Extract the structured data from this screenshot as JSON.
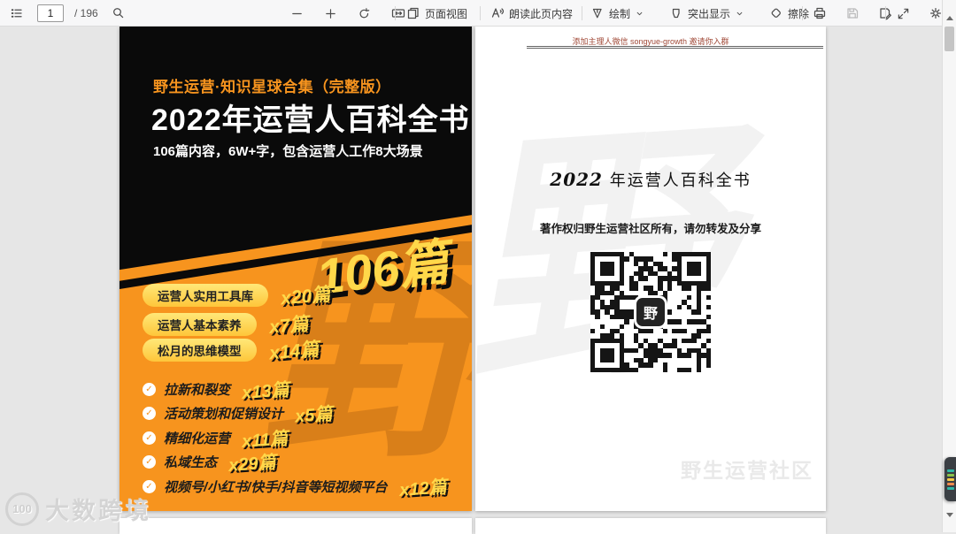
{
  "toolbar": {
    "page_input": "1",
    "page_total": "/ 196",
    "page_view_label": "页面视图",
    "read_aloud_label": "朗读此页内容",
    "draw_label": "绘制",
    "highlight_label": "突出显示",
    "erase_label": "擦除"
  },
  "left_page": {
    "kicker": "野生运营·知识星球合集（完整版）",
    "title": "2022年运营人百科全书",
    "subtitle": "106篇内容，6W+字，包含运营人工作8大场景",
    "badge": "106篇",
    "watermark": "野",
    "pills": [
      {
        "label": "运营人实用工具库",
        "count": "x20篇"
      },
      {
        "label": "运营人基本素养",
        "count": "x7篇"
      },
      {
        "label": "松月的思维模型",
        "count": "x14篇"
      }
    ],
    "checklist": [
      {
        "label": "拉新和裂变",
        "count": "x13篇"
      },
      {
        "label": "活动策划和促销设计",
        "count": "x5篇"
      },
      {
        "label": "精细化运营",
        "count": "x11篇"
      },
      {
        "label": "私域生态",
        "count": "x29篇"
      },
      {
        "label": "视频号/小红书/快手/抖音等短视频平台",
        "count": "x12篇"
      }
    ]
  },
  "right_page": {
    "header_note": "添加主理人微信 songyue-growth 邀请你入群",
    "title_year": "2022",
    "title_rest": " 年运营人百科全书",
    "copyright": "著作权归野生运营社区所有，请勿转发及分享",
    "qr_logo": "野",
    "watermark": "野",
    "footer_watermark": "野生运营社区"
  },
  "overlay": {
    "brand_number": "100",
    "brand_text": "大数跨境"
  },
  "colors": {
    "accent_orange": "#F7941E",
    "accent_yellow": "#FFD84A",
    "page_black": "#0a0a0a"
  },
  "icons": {
    "check_glyph": "✓"
  }
}
